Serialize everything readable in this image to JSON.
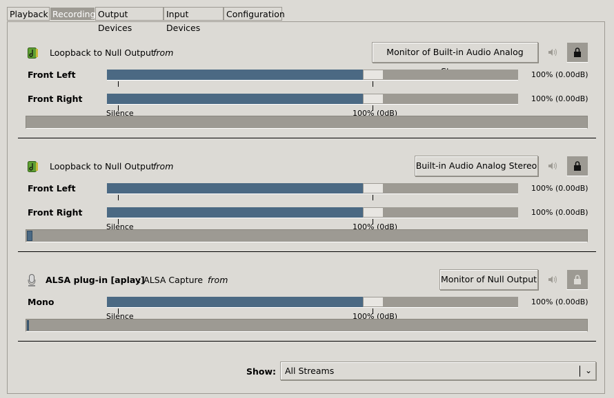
{
  "tabs": [
    {
      "label": "Playback"
    },
    {
      "label": "Recording",
      "active": true
    },
    {
      "label": "Output Devices"
    },
    {
      "label": "Input Devices"
    },
    {
      "label": "Configuration"
    }
  ],
  "scale": {
    "silence": "Silence",
    "norm": "100% (0dB)"
  },
  "streams": [
    {
      "icon": "audio-stream-icon",
      "name": "Loopback to Null Output",
      "app": "",
      "from": "from",
      "device": "Monitor of Built-in Audio Analog Stereo",
      "locked": true,
      "level_percent": 0,
      "channels": [
        {
          "label": "Front Left",
          "value": "100% (0.00dB)",
          "volume_percent": 100
        },
        {
          "label": "Front Right",
          "value": "100% (0.00dB)",
          "volume_percent": 100
        }
      ]
    },
    {
      "icon": "audio-stream-icon",
      "name": "Loopback to Null Output",
      "app": "",
      "from": "from",
      "device": "Built-in Audio Analog Stereo",
      "locked": true,
      "level_percent": 1,
      "channels": [
        {
          "label": "Front Left",
          "value": "100% (0.00dB)",
          "volume_percent": 100
        },
        {
          "label": "Front Right",
          "value": "100% (0.00dB)",
          "volume_percent": 100
        }
      ]
    },
    {
      "icon": "microphone-icon",
      "name": "ALSA plug-in [aplay]",
      "app": ": ALSA Capture",
      "from": "from",
      "device": "Monitor of Null Output",
      "locked": false,
      "level_percent": 0.3,
      "channels": [
        {
          "label": "Mono",
          "value": "100% (0.00dB)",
          "volume_percent": 100
        }
      ]
    }
  ],
  "footer": {
    "show_label": "Show:",
    "show_value": "All Streams"
  },
  "colors": {
    "accent": "#4b6983",
    "trough": "#9d9a93",
    "background": "#dcdad5"
  }
}
